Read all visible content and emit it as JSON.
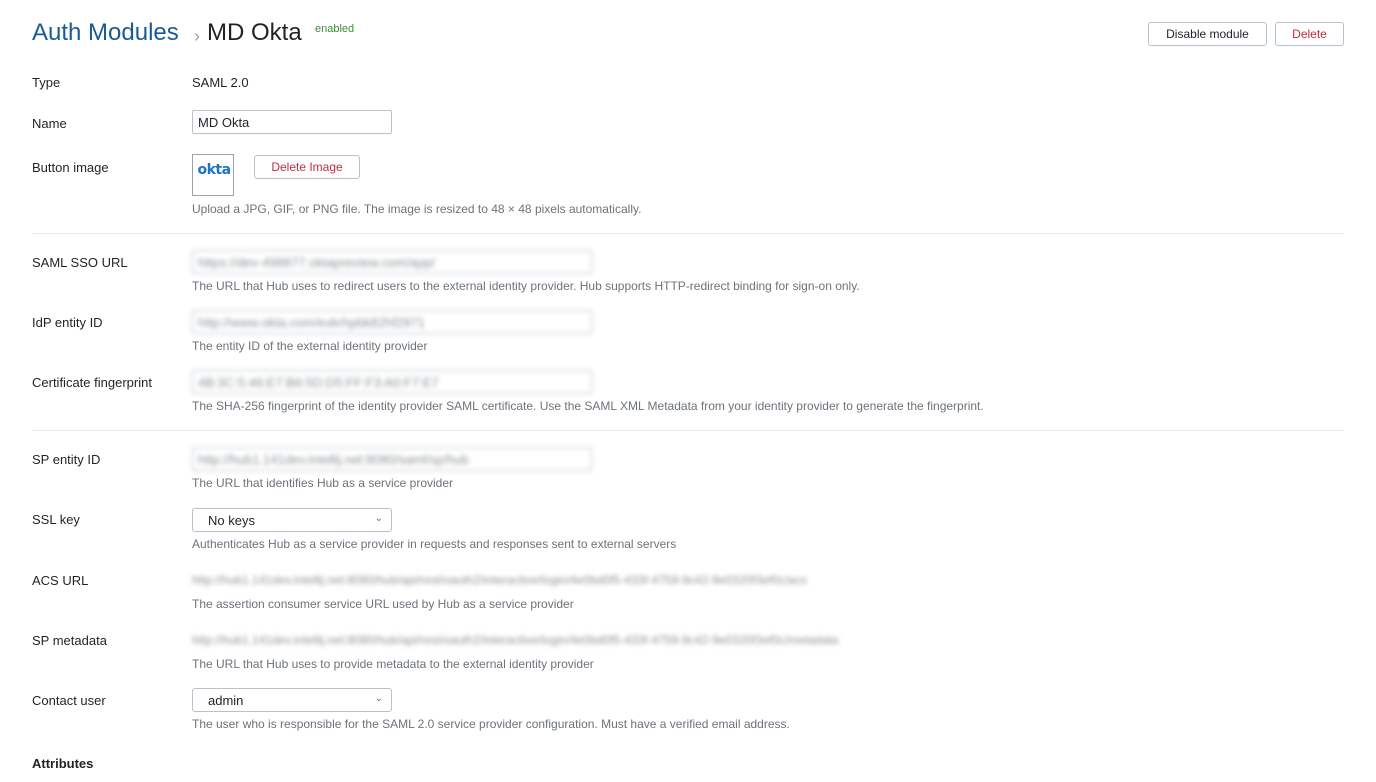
{
  "header": {
    "breadcrumb": "Auth Modules",
    "separator": "›",
    "title": "MD Okta",
    "status": "enabled"
  },
  "actions": {
    "disable_label": "Disable module",
    "delete_label": "Delete"
  },
  "fields": {
    "type": {
      "label": "Type",
      "value": "SAML 2.0"
    },
    "name": {
      "label": "Name",
      "value": "MD Okta"
    },
    "button_image": {
      "label": "Button image",
      "logo_text": "okta",
      "delete_label": "Delete Image",
      "hint": "Upload a JPG, GIF, or PNG file. The image is resized to 48 × 48 pixels automatically."
    },
    "saml_sso_url": {
      "label": "SAML SSO URL",
      "value": "https://dev-498877.oktapreview.com/app/",
      "hint": "The URL that Hub uses to redirect users to the external identity provider. Hub supports HTTP-redirect binding for sign-on only."
    },
    "idp_entity_id": {
      "label": "IdP entity ID",
      "value": "http://www.okta.com/exkrhpbk82hf2971",
      "hint": "The entity ID of the external identity provider"
    },
    "cert_fingerprint": {
      "label": "Certificate fingerprint",
      "value": "4B:3C:5:46:E7:B6:5D:D5:FF:F3:A0:F7:E7",
      "hint": "The SHA-256 fingerprint of the identity provider SAML certificate. Use the SAML XML Metadata from your identity provider to generate the fingerprint."
    },
    "sp_entity_id": {
      "label": "SP entity ID",
      "value": "http://hub1.141dev.intellij.net:8080/saml/sp/hub",
      "hint": "The URL that identifies Hub as a service provider"
    },
    "ssl_key": {
      "label": "SSL key",
      "value": "No keys",
      "hint": "Authenticates Hub as a service provider in requests and responses sent to external servers"
    },
    "acs_url": {
      "label": "ACS URL",
      "value": "http://hub1.141dev.intellij.net:8080/hub/api/rest/oauth2/interactive/login/4e0bd0f5-433f-4759-9c42-9e0320f3ef0c/acs",
      "hint": "The assertion consumer service URL used by Hub as a service provider"
    },
    "sp_metadata": {
      "label": "SP metadata",
      "value": "http://hub1.141dev.intellij.net:8080/hub/api/rest/oauth2/interactive/login/4e0bd0f5-433f-4759-9c42-9e0320f3ef0c/metadata",
      "hint": "The URL that Hub uses to provide metadata to the external identity provider"
    },
    "contact_user": {
      "label": "Contact user",
      "value": "admin",
      "hint": "The user who is responsible for the SAML 2.0 service provider configuration. Must have a verified email address."
    }
  },
  "attributes": {
    "title": "Attributes"
  },
  "icons": {
    "dropdown": "chevron-down-icon",
    "chevron_glyph": "⌄"
  },
  "colors": {
    "link": "#1a5b96",
    "status": "#3c8d3c",
    "danger": "#c22d3a",
    "okta": "#1a74c9"
  }
}
